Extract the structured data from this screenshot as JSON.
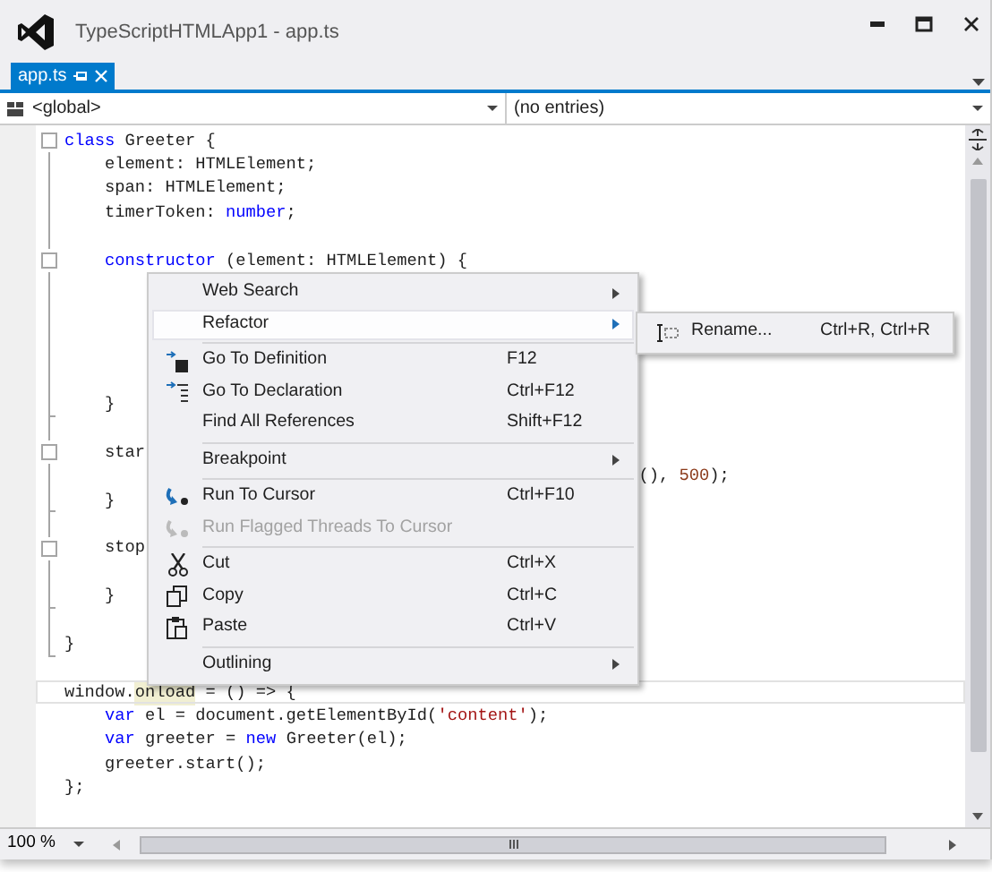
{
  "window": {
    "title": "TypeScriptHTMLApp1 - app.ts"
  },
  "tabs": [
    {
      "label": "app.ts",
      "selected": true
    }
  ],
  "navigation": {
    "scope": "<global>",
    "members": "(no entries)"
  },
  "code_lines": [
    {
      "kind": "fold_start",
      "tokens": [
        {
          "text": "class",
          "kind": "keyword"
        },
        {
          "text": " Greeter {",
          "kind": "plain"
        }
      ]
    },
    {
      "kind": "in_fold",
      "tokens": [
        {
          "text": "    element: HTMLElement;",
          "kind": "plain"
        }
      ]
    },
    {
      "kind": "in_fold",
      "tokens": [
        {
          "text": "    span: HTMLElement;",
          "kind": "plain"
        }
      ]
    },
    {
      "kind": "in_fold",
      "tokens": [
        {
          "text": "    timerToken: ",
          "kind": "plain"
        },
        {
          "text": "number",
          "kind": "keyword"
        },
        {
          "text": ";",
          "kind": "plain"
        }
      ]
    },
    {
      "kind": "in_fold"
    },
    {
      "kind": "fold_start",
      "tokens": [
        {
          "text": "    constructor",
          "kind": "keyword"
        },
        {
          "text": " (element: HTMLElement) {",
          "kind": "plain"
        }
      ]
    },
    {
      "kind": "in_fold"
    },
    {
      "kind": "in_fold"
    },
    {
      "kind": "in_fold"
    },
    {
      "kind": "in_fold"
    },
    {
      "kind": "in_fold"
    },
    {
      "kind": "fold_end",
      "tokens": [
        {
          "text": "    }",
          "kind": "plain"
        }
      ]
    },
    {
      "kind": "in_fold"
    },
    {
      "kind": "fold_start",
      "tokens": [
        {
          "text": "    star",
          "kind": "plain"
        }
      ]
    },
    {
      "kind": "in_fold",
      "tokens": [
        {
          "text": "                                                         (), ",
          "kind": "plain"
        },
        {
          "text": "500",
          "kind": "number"
        },
        {
          "text": ");",
          "kind": "plain"
        }
      ]
    },
    {
      "kind": "fold_end",
      "tokens": [
        {
          "text": "    }",
          "kind": "plain"
        }
      ]
    },
    {
      "kind": "in_fold"
    },
    {
      "kind": "fold_start",
      "tokens": [
        {
          "text": "    stop",
          "kind": "plain"
        }
      ]
    },
    {
      "kind": "in_fold"
    },
    {
      "kind": "fold_end",
      "tokens": [
        {
          "text": "    }",
          "kind": "plain"
        }
      ]
    },
    {
      "kind": "in_fold"
    },
    {
      "kind": "fold_end",
      "tokens": [
        {
          "text": "}",
          "kind": "plain"
        }
      ]
    },
    {
      "kind": "plain"
    },
    {
      "kind": "plain",
      "current": true,
      "tokens": [
        {
          "text": "window.",
          "kind": "plain"
        },
        {
          "text": "onload",
          "kind": "reference"
        },
        {
          "text": " = () => {",
          "kind": "plain"
        }
      ]
    },
    {
      "kind": "plain",
      "tokens": [
        {
          "text": "    var",
          "kind": "keyword"
        },
        {
          "text": " el = document.getElementById(",
          "kind": "plain"
        },
        {
          "text": "'content'",
          "kind": "string"
        },
        {
          "text": ");",
          "kind": "plain"
        }
      ]
    },
    {
      "kind": "plain",
      "tokens": [
        {
          "text": "    var",
          "kind": "keyword"
        },
        {
          "text": " greeter = ",
          "kind": "plain"
        },
        {
          "text": "new",
          "kind": "keyword"
        },
        {
          "text": " Greeter(el);",
          "kind": "plain"
        }
      ]
    },
    {
      "kind": "plain",
      "tokens": [
        {
          "text": "    greeter.start();",
          "kind": "plain"
        }
      ]
    },
    {
      "kind": "plain",
      "tokens": [
        {
          "text": "};",
          "kind": "plain"
        }
      ]
    }
  ],
  "context_menu": [
    {
      "kind": "item",
      "label": "Web Search",
      "submenu": true,
      "selected": false,
      "disabled": false
    },
    {
      "kind": "item",
      "label": "Refactor",
      "submenu": true,
      "selected": true,
      "disabled": false
    },
    {
      "kind": "separator"
    },
    {
      "kind": "item",
      "label": "Go To Definition",
      "shortcut": "F12",
      "submenu": false,
      "selected": false,
      "disabled": false
    },
    {
      "kind": "item",
      "label": "Go To Declaration",
      "shortcut": "Ctrl+F12",
      "submenu": false,
      "selected": false,
      "disabled": false
    },
    {
      "kind": "item",
      "label": "Find All References",
      "shortcut": "Shift+F12",
      "submenu": false,
      "selected": false,
      "disabled": false
    },
    {
      "kind": "separator"
    },
    {
      "kind": "item",
      "label": "Breakpoint",
      "submenu": true,
      "selected": false,
      "disabled": false
    },
    {
      "kind": "separator"
    },
    {
      "kind": "item",
      "label": "Run To Cursor",
      "shortcut": "Ctrl+F10",
      "submenu": false,
      "selected": false,
      "disabled": false
    },
    {
      "kind": "item",
      "label": "Run Flagged Threads To Cursor",
      "submenu": false,
      "selected": false,
      "disabled": true
    },
    {
      "kind": "separator"
    },
    {
      "kind": "item",
      "label": "Cut",
      "shortcut": "Ctrl+X",
      "submenu": false,
      "selected": false,
      "disabled": false
    },
    {
      "kind": "item",
      "label": "Copy",
      "shortcut": "Ctrl+C",
      "submenu": false,
      "selected": false,
      "disabled": false
    },
    {
      "kind": "item",
      "label": "Paste",
      "shortcut": "Ctrl+V",
      "submenu": false,
      "selected": false,
      "disabled": false
    },
    {
      "kind": "separator"
    },
    {
      "kind": "item",
      "label": "Outlining",
      "submenu": true,
      "selected": false,
      "disabled": false
    }
  ],
  "submenu": [
    {
      "label": "Rename...",
      "shortcut": "Ctrl+R, Ctrl+R"
    }
  ],
  "status_bar": {
    "zoom": "100 %"
  }
}
